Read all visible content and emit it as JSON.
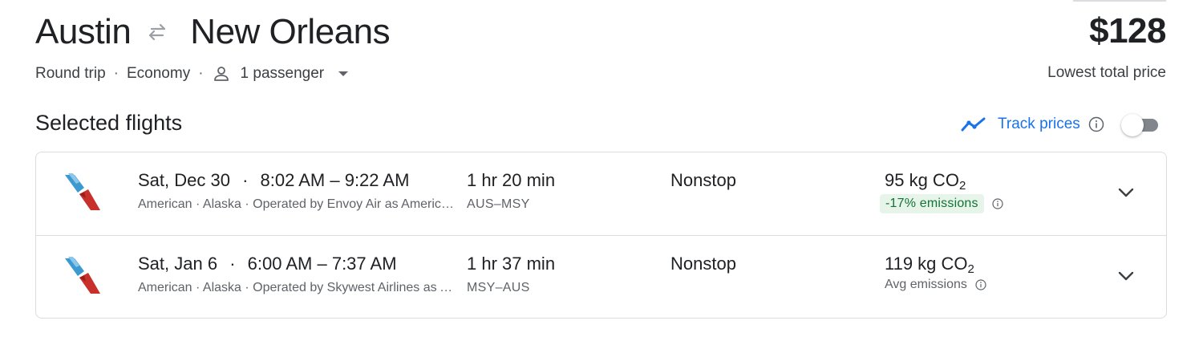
{
  "header": {
    "origin": "Austin",
    "destination": "New Orleans",
    "swap_icon": "swap-arrows-icon",
    "price": "$128",
    "price_caption": "Lowest total price",
    "trip_type": "Round trip",
    "cabin_class": "Economy",
    "passengers": "1 passenger",
    "separator": "·"
  },
  "selected": {
    "title": "Selected flights",
    "track_label": "Track prices",
    "track_enabled": false
  },
  "flights": [
    {
      "date": "Sat, Dec 30",
      "times": "8:02 AM – 9:22 AM",
      "airlines": "American · Alaska · Operated by Envoy Air as American Eagle",
      "duration": "1 hr 20 min",
      "route": "AUS–MSY",
      "stops": "Nonstop",
      "co2_value": "95 kg CO",
      "co2_sub": "2",
      "emissions": "-17% emissions",
      "emissions_type": "badge"
    },
    {
      "date": "Sat, Jan 6",
      "times": "6:00 AM – 7:37 AM",
      "airlines": "American · Alaska · Operated by Skywest Airlines as American Eagle",
      "duration": "1 hr 37 min",
      "route": "MSY–AUS",
      "stops": "Nonstop",
      "co2_value": "119 kg CO",
      "co2_sub": "2",
      "emissions": "Avg emissions",
      "emissions_type": "text"
    }
  ],
  "colors": {
    "accent": "#1a73e8",
    "badge_bg": "#e6f4ea",
    "badge_text": "#137333",
    "border": "#dadce0",
    "airline_red": "#c8312b",
    "airline_blue": "#3d9ad1"
  }
}
